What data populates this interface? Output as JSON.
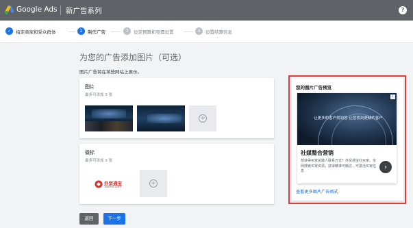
{
  "app": {
    "name": "Google Ads",
    "campaign_title": "新广告系列",
    "help_label": "?"
  },
  "steps": [
    {
      "label": "指定商家和受众群体",
      "state": "done",
      "number": "✓"
    },
    {
      "label": "制作广告",
      "state": "current",
      "number": "2"
    },
    {
      "label": "设定预算和竞價设置",
      "state": "todo",
      "number": "3"
    },
    {
      "label": "设置结算信息",
      "state": "todo",
      "number": "4"
    }
  ],
  "main": {
    "title": "为您的广告添加图片（可选）",
    "subtitle": "图片广告将在某些网站上展示。"
  },
  "images_card": {
    "title": "图片",
    "hint": "最多可添加 3 张",
    "add_symbol": "+"
  },
  "logo_card": {
    "title": "徽标",
    "hint": "最多可添加 3 张",
    "logo_text": "外贸通宝",
    "logo_subtext": "TaoPai.com",
    "add_symbol": "+"
  },
  "buttons": {
    "back": "返回",
    "next": "下一步"
  },
  "preview": {
    "title": "您的图片广告预览",
    "image_text": "让更多的客户找到您 让您找到更精的客户",
    "info_badge": "i",
    "headline": "社媒整合营销",
    "description": "想获得买家关键人联系方式？外贸通宝社买家。全网搜索买家资源，获得精准可触达，可激活买家信息",
    "arrow": "›",
    "more_link": "查看更多图片广告格式"
  },
  "colors": {
    "topbar": "#5f6368",
    "accent": "#1a73e8",
    "button_gray": "#5f6368",
    "highlight_border": "#e53935",
    "logo_red": "#d6312b"
  }
}
